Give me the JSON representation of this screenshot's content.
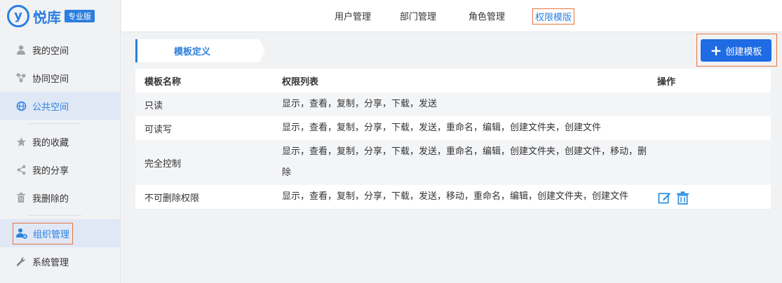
{
  "app": {
    "logo_mark": "y",
    "logo_text": "悦库",
    "edition_badge": "专业版"
  },
  "sidebar": {
    "items": [
      {
        "label": "我的空间",
        "icon": "user-icon"
      },
      {
        "label": "协同空间",
        "icon": "share-nodes-icon"
      },
      {
        "label": "公共空间",
        "icon": "globe-icon",
        "active": true
      },
      {
        "label": "我的收藏",
        "icon": "star-icon"
      },
      {
        "label": "我的分享",
        "icon": "share-icon"
      },
      {
        "label": "我删除的",
        "icon": "trash-icon"
      },
      {
        "label": "组织管理",
        "icon": "org-settings-icon",
        "active": true
      },
      {
        "label": "系统管理",
        "icon": "wrench-icon"
      }
    ]
  },
  "topnav": {
    "tabs": [
      {
        "label": "用户管理"
      },
      {
        "label": "部门管理"
      },
      {
        "label": "角色管理"
      },
      {
        "label": "权限模版",
        "active": true
      }
    ]
  },
  "main": {
    "section_tab": "模板定义",
    "create_button": "创建模板",
    "table": {
      "headers": [
        "模板名称",
        "权限列表",
        "操作"
      ],
      "rows": [
        {
          "name": "只读",
          "perms": "显示，查看，复制，分享，下载，发送"
        },
        {
          "name": "可读写",
          "perms": "显示，查看，复制，分享，下载，发送，重命名，编辑，创建文件夹，创建文件"
        },
        {
          "name": "完全控制",
          "perms": "显示，查看，复制，分享，下载，发送，重命名，编辑，创建文件夹，创建文件，移动，删除"
        },
        {
          "name": "不可删除权限",
          "perms": "显示，查看，复制，分享，下载，发送，移动，重命名，编辑，创建文件夹，创建文件",
          "has_actions": true
        }
      ]
    }
  },
  "colors": {
    "accent": "#2b7fe0",
    "button": "#1f6be3",
    "highlight_border": "#e8743b",
    "active_bg": "#e0e8f6"
  }
}
